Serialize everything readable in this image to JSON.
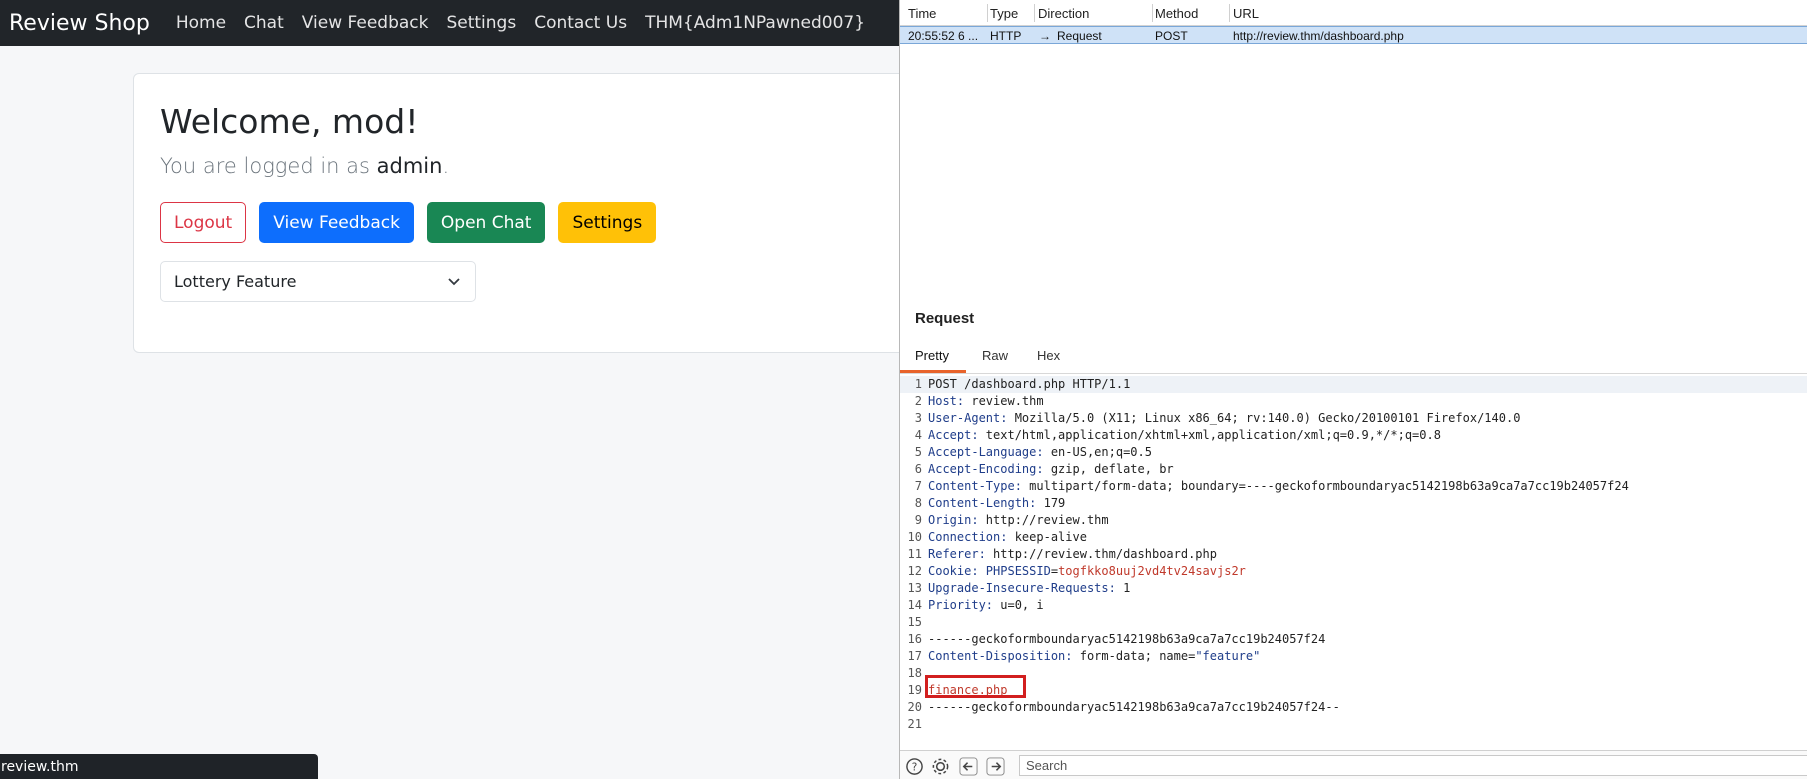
{
  "navbar": {
    "brand": "Review Shop",
    "links": [
      "Home",
      "Chat",
      "View Feedback",
      "Settings",
      "Contact Us",
      "THM{Adm1NPawned007}"
    ]
  },
  "dashboard": {
    "welcome": "Welcome, mod!",
    "logged_prefix": "You are logged in as ",
    "logged_user": "admin",
    "logged_suffix": ".",
    "buttons": {
      "logout": "Logout",
      "view_feedback": "View Feedback",
      "open_chat": "Open Chat",
      "settings": "Settings"
    },
    "select_value": "Lottery Feature"
  },
  "status_bar": {
    "text": "review.thm"
  },
  "burp": {
    "columns": [
      "Time",
      "Type",
      "Direction",
      "Method",
      "URL"
    ],
    "row": {
      "time": "20:55:52 6 ...",
      "type": "HTTP",
      "direction": "Request",
      "method": "POST",
      "url": "http://review.thm/dashboard.php"
    },
    "request_title": "Request",
    "tabs": [
      "Pretty",
      "Raw",
      "Hex"
    ],
    "active_tab": "Pretty",
    "lines": [
      {
        "n": "1",
        "plain": "POST /dashboard.php HTTP/1.1"
      },
      {
        "n": "2",
        "key": "Host:",
        "val": " review.thm"
      },
      {
        "n": "3",
        "key": "User-Agent:",
        "val": " Mozilla/5.0 (X11; Linux x86_64; rv:140.0) Gecko/20100101 Firefox/140.0"
      },
      {
        "n": "4",
        "key": "Accept:",
        "val": " text/html,application/xhtml+xml,application/xml;q=0.9,*/*;q=0.8"
      },
      {
        "n": "5",
        "key": "Accept-Language:",
        "val": " en-US,en;q=0.5"
      },
      {
        "n": "6",
        "key": "Accept-Encoding:",
        "val": " gzip, deflate, br"
      },
      {
        "n": "7",
        "key": "Content-Type:",
        "val": " multipart/form-data; boundary=----geckoformboundaryac5142198b63a9ca7a7cc19b24057f24"
      },
      {
        "n": "8",
        "key": "Content-Length:",
        "val": " 179"
      },
      {
        "n": "9",
        "key": "Origin:",
        "val": " http://review.thm"
      },
      {
        "n": "10",
        "key": "Connection:",
        "val": " keep-alive"
      },
      {
        "n": "11",
        "key": "Referer:",
        "val": " http://review.thm/dashboard.php"
      },
      {
        "n": "12",
        "key": "Cookie:",
        "cookie_name": " PHPSESSID",
        "eq": "=",
        "cookie_val": "togfkko8uuj2vd4tv24savjs2r"
      },
      {
        "n": "13",
        "key": "Upgrade-Insecure-Requests:",
        "val": " 1"
      },
      {
        "n": "14",
        "key": "Priority:",
        "val": " u=0, i"
      },
      {
        "n": "15",
        "plain": ""
      },
      {
        "n": "16",
        "plain": "------geckoformboundaryac5142198b63a9ca7a7cc19b24057f24"
      },
      {
        "n": "17",
        "key": "Content-Disposition:",
        "val": " form-data; name=",
        "quoted": "\"feature\""
      },
      {
        "n": "18",
        "plain": ""
      },
      {
        "n": "19",
        "red": "finance.php"
      },
      {
        "n": "20",
        "plain": "------geckoformboundaryac5142198b63a9ca7a7cc19b24057f24--"
      },
      {
        "n": "21",
        "plain": ""
      }
    ],
    "search_placeholder": "Search"
  }
}
